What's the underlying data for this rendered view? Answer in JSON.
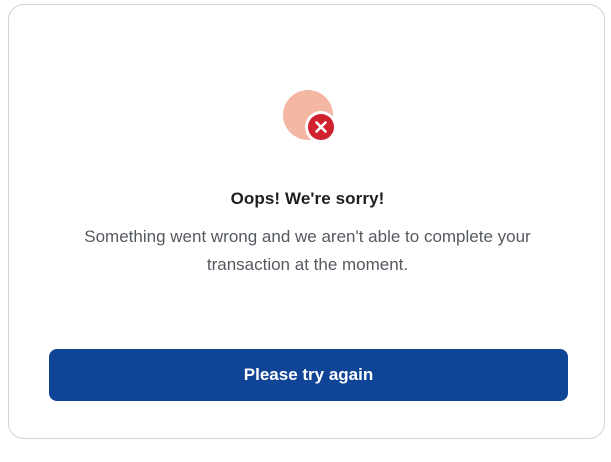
{
  "dialog": {
    "icon": "error-x-icon",
    "title": "Oops! We're sorry!",
    "message": "Something went wrong and we aren't able to complete your transaction at the moment.",
    "retry_label": "Please try again"
  },
  "colors": {
    "button_bg": "#0f4496",
    "icon_back_circle": "#f4b7a4",
    "icon_badge": "#d0212f",
    "message_text": "#555a60",
    "card_border": "#cfd2d6"
  }
}
